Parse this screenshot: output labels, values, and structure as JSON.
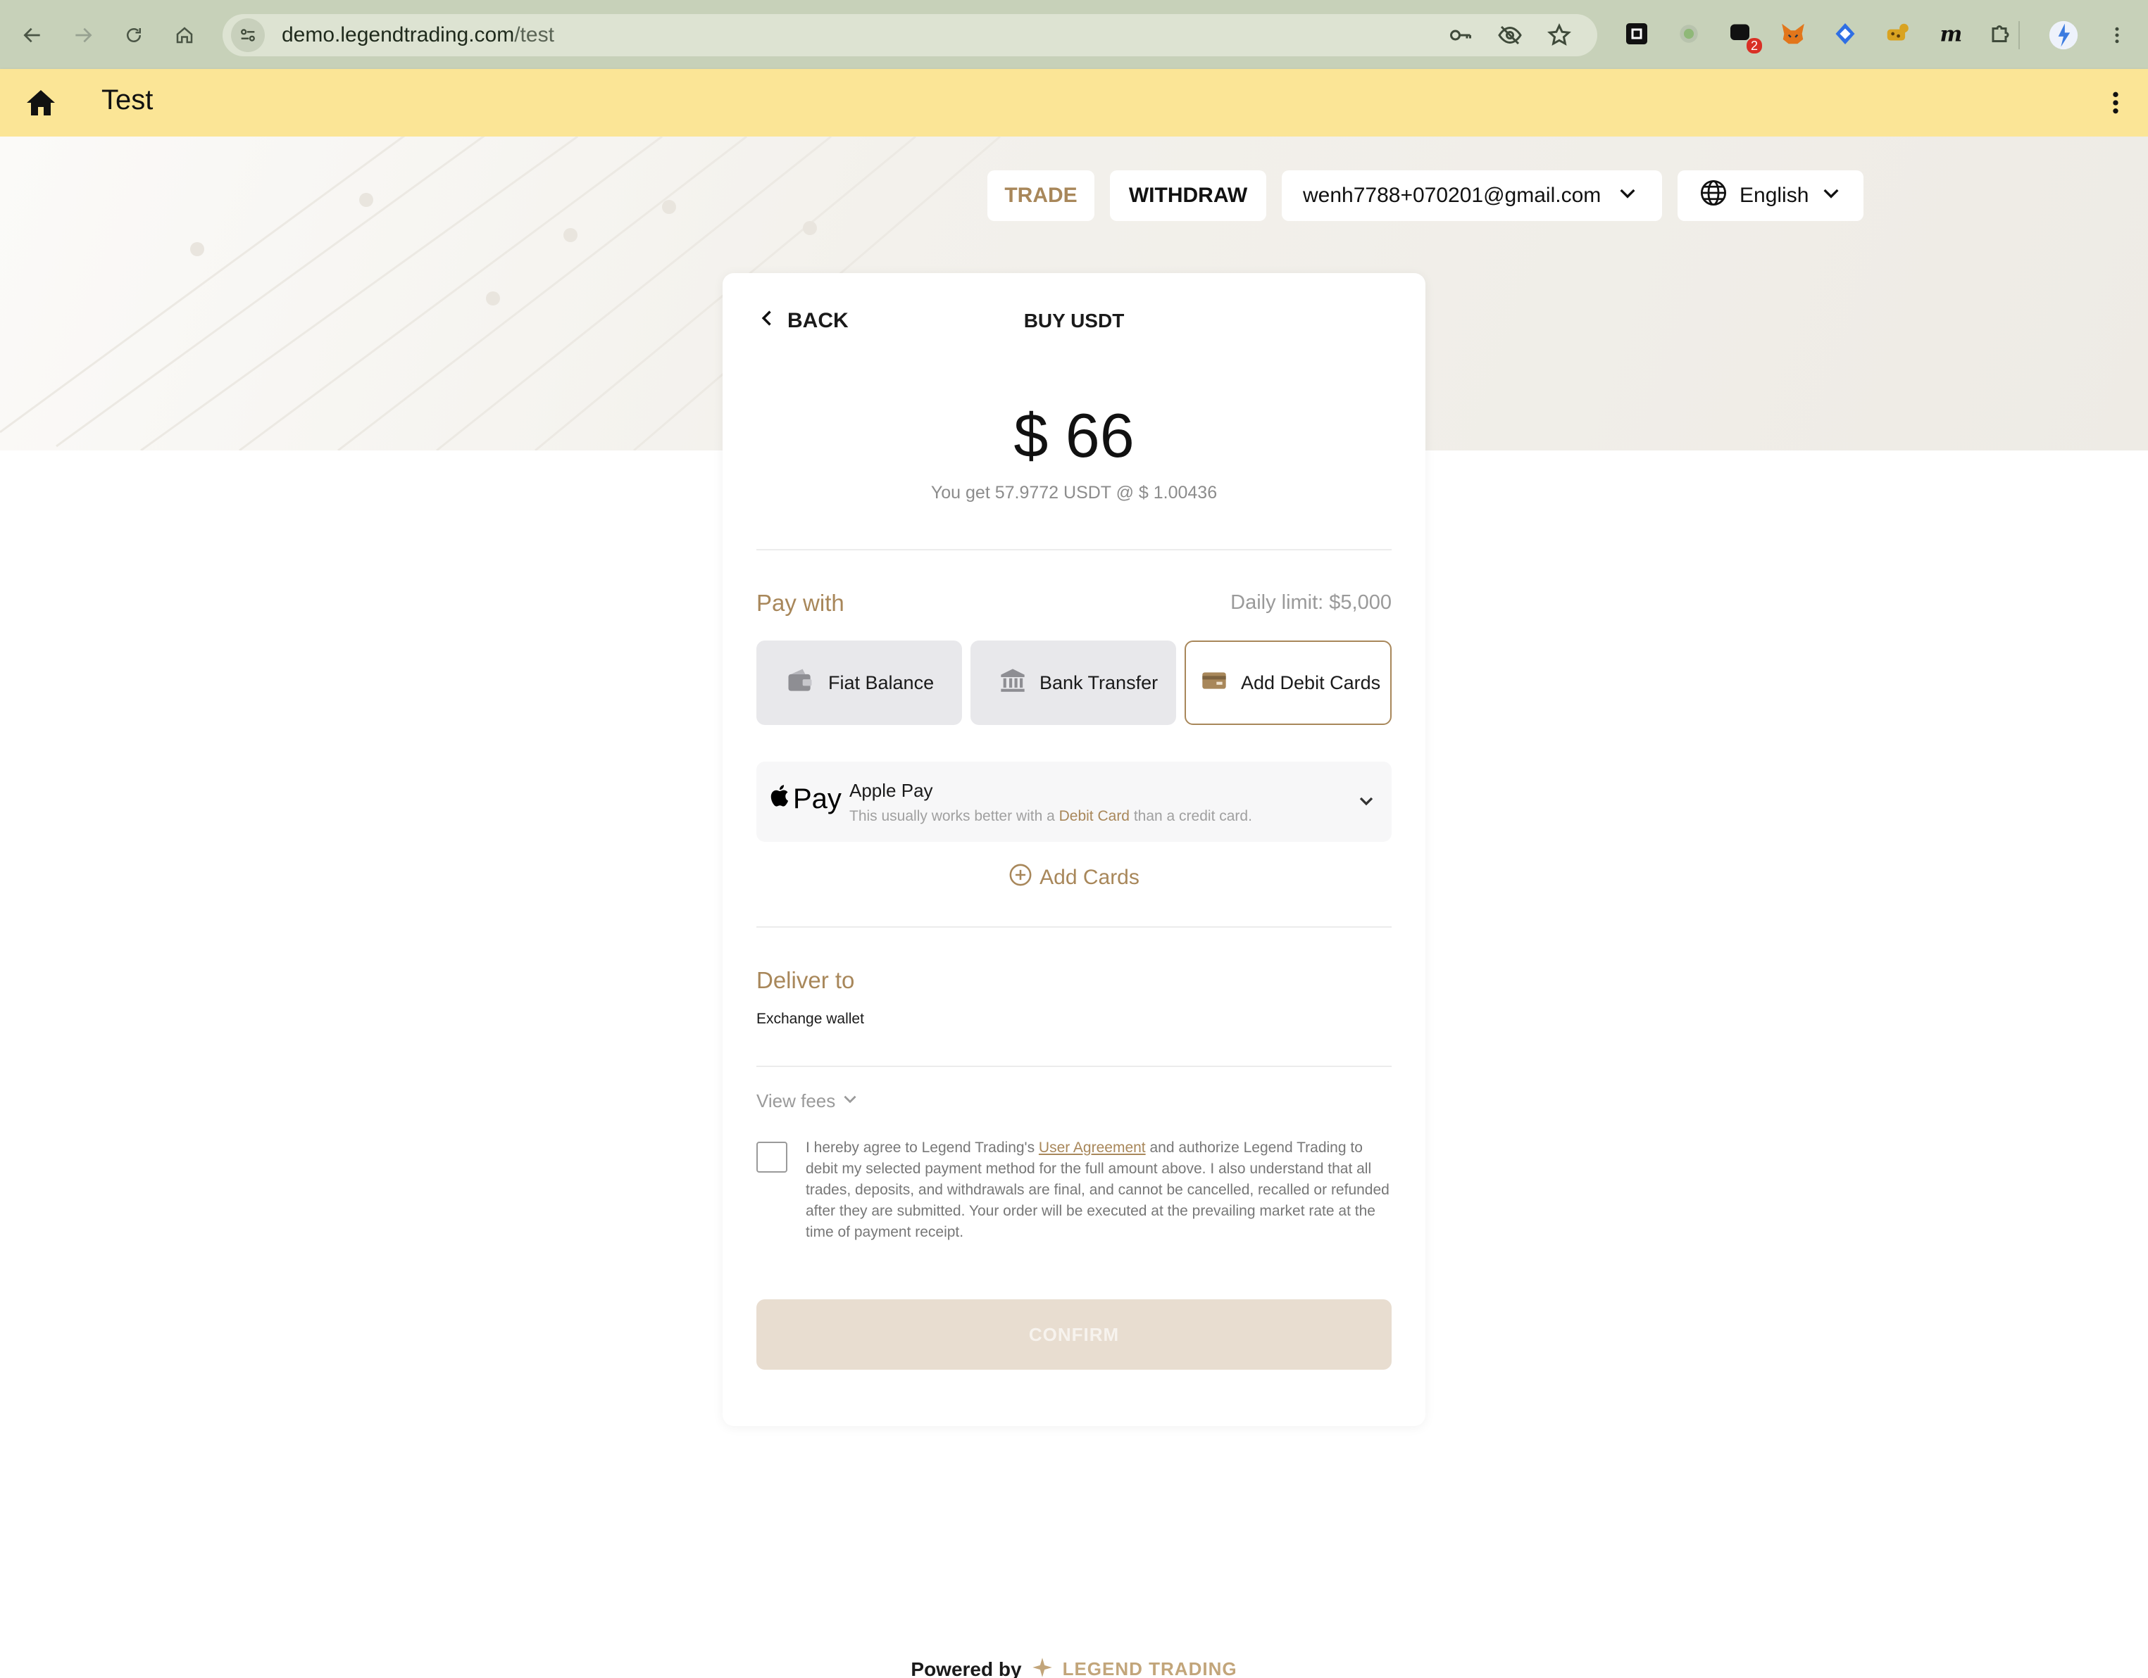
{
  "browser": {
    "url_domain": "demo.legendtrading.com",
    "url_path": "/test",
    "extension_badge": "2"
  },
  "appbar": {
    "title": "Test"
  },
  "topnav": {
    "trade": "TRADE",
    "withdraw": "WITHDRAW",
    "account_email": "wenh7788+070201@gmail.com",
    "language": "English"
  },
  "card": {
    "back_label": "BACK",
    "title": "BUY USDT",
    "amount": "$ 66",
    "you_get": "You get 57.9772 USDT @ $ 1.00436",
    "pay_with_label": "Pay with",
    "daily_limit": "Daily limit: $5,000",
    "payment_methods": [
      {
        "label": "Fiat Balance",
        "icon": "wallet-icon",
        "selected": false
      },
      {
        "label": "Bank Transfer",
        "icon": "bank-icon",
        "selected": false
      },
      {
        "label": "Add Debit Cards",
        "icon": "card-icon",
        "selected": true
      }
    ],
    "apple_pay": {
      "logo_text": "Pay",
      "name": "Apple Pay",
      "hint_before": "This usually works better with a ",
      "hint_highlight": "Debit Card",
      "hint_after": " than a credit card."
    },
    "add_cards": "Add Cards",
    "deliver_to_label": "Deliver to",
    "deliver_to_value": "Exchange wallet",
    "view_fees": "View fees",
    "agreement": {
      "before": "I hereby agree to Legend Trading's ",
      "link": "User Agreement",
      "after": " and authorize Legend Trading to debit my selected payment method for the full amount above. I also understand that all trades, deposits, and withdrawals are final, and cannot be cancelled, recalled or refunded after they are submitted. Your order will be executed at the prevailing market rate at the time of payment receipt.",
      "checked": false
    },
    "confirm": "CONFIRM"
  },
  "footer": {
    "powered_by": "Powered by",
    "brand": "LEGEND TRADING"
  },
  "colors": {
    "accent": "#a8875a",
    "appbar": "#fbe596",
    "chrome": "#c7d1b9",
    "confirm_disabled": "#e8ddd0"
  }
}
